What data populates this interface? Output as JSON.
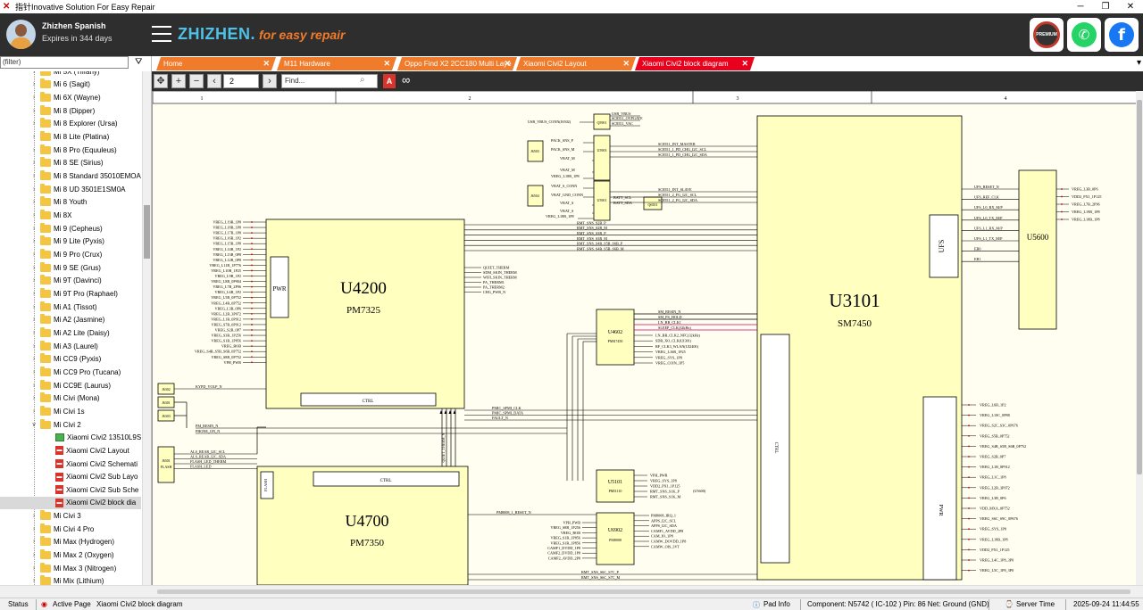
{
  "window": {
    "title": "指针Inovative Solution For Easy Repair",
    "controls": [
      "─",
      "❐",
      "✕"
    ]
  },
  "header": {
    "user_name": "Zhizhen Spanish",
    "expires": "Expires in 344 days",
    "brand": "ZHIZHEN.",
    "tagline": "for easy repair",
    "premium_label": "PREMIUM",
    "whatsapp_glyph": "✆",
    "facebook_glyph": "f"
  },
  "sidebar": {
    "filter_placeholder": "(filter)",
    "items": [
      {
        "label": "Mi 5X (Tiffany)",
        "type": "folder"
      },
      {
        "label": "Mi 6 (Sagit)",
        "type": "folder"
      },
      {
        "label": "Mi 6X (Wayne)",
        "type": "folder"
      },
      {
        "label": "Mi 8 (Dipper)",
        "type": "folder"
      },
      {
        "label": "Mi 8 Explorer (Ursa)",
        "type": "folder"
      },
      {
        "label": "Mi 8 Lite (Platina)",
        "type": "folder"
      },
      {
        "label": "Mi 8 Pro (Equuleus)",
        "type": "folder"
      },
      {
        "label": "Mi 8 SE (Sirius)",
        "type": "folder"
      },
      {
        "label": "Mi 8 Standard 35010EMOA",
        "type": "folder"
      },
      {
        "label": "Mi 8 UD 3501E1SM0A",
        "type": "folder"
      },
      {
        "label": "Mi 8 Youth",
        "type": "folder"
      },
      {
        "label": "Mi 8X",
        "type": "folder"
      },
      {
        "label": "Mi 9 (Cepheus)",
        "type": "folder"
      },
      {
        "label": "Mi 9 Lite (Pyxis)",
        "type": "folder"
      },
      {
        "label": "Mi 9 Pro (Crux)",
        "type": "folder"
      },
      {
        "label": "Mi 9 SE (Grus)",
        "type": "folder"
      },
      {
        "label": "Mi 9T (Davinci)",
        "type": "folder"
      },
      {
        "label": "Mi 9T Pro (Raphael)",
        "type": "folder"
      },
      {
        "label": "Mi A1 (Tissot)",
        "type": "folder"
      },
      {
        "label": "Mi A2 (Jasmine)",
        "type": "folder"
      },
      {
        "label": "Mi A2 Lite (Daisy)",
        "type": "folder"
      },
      {
        "label": "Mi A3 (Laurel)",
        "type": "folder"
      },
      {
        "label": "Mi CC9 (Pyxis)",
        "type": "folder"
      },
      {
        "label": "Mi CC9 Pro (Tucana)",
        "type": "folder"
      },
      {
        "label": "Mi CC9E (Laurus)",
        "type": "folder"
      },
      {
        "label": "Mi Civi (Mona)",
        "type": "folder"
      },
      {
        "label": "Mi Civi 1s",
        "type": "folder"
      },
      {
        "label": "Mi Civi 2",
        "type": "folder-open"
      },
      {
        "label": "Xiaomi Civi2 13510L9S",
        "type": "bitmap"
      },
      {
        "label": "Xiaomi Civi2 Layout",
        "type": "pdf"
      },
      {
        "label": "Xiaomi Civi2 Schemati",
        "type": "pdf"
      },
      {
        "label": "Xiaomi Civi2 Sub Layo",
        "type": "pdf"
      },
      {
        "label": "Xiaomi Civi2 Sub Sche",
        "type": "pdf"
      },
      {
        "label": "Xiaomi Civi2 block dia",
        "type": "pdf",
        "selected": true
      },
      {
        "label": "Mi Civi 3",
        "type": "folder"
      },
      {
        "label": "Mi Civi 4 Pro",
        "type": "folder"
      },
      {
        "label": "Mi Max (Hydrogen)",
        "type": "folder"
      },
      {
        "label": "Mi Max 2 (Oxygen)",
        "type": "folder"
      },
      {
        "label": "Mi Max 3 (Nitrogen)",
        "type": "folder"
      },
      {
        "label": "Mi Mix (Lithium)",
        "type": "folder"
      }
    ]
  },
  "tabs": [
    {
      "label": "Home",
      "active": false
    },
    {
      "label": "M11 Hardware",
      "active": false
    },
    {
      "label": "Oppo Find X2 2CC180 Multi Laye",
      "active": false
    },
    {
      "label": "Xiaomi Civi2 Layout",
      "active": false
    },
    {
      "label": "Xiaomi Civi2 block diagram",
      "active": true
    }
  ],
  "toolbar": {
    "page": "2",
    "find_placeholder": "Find...",
    "pdf_label": "A"
  },
  "schematic": {
    "columns": [
      "1",
      "2",
      "3",
      "4"
    ],
    "u4200": {
      "name": "U4200",
      "part": "PM7325",
      "pwr": "PWR",
      "ctrl": "CTRL"
    },
    "u3101": {
      "name": "U3101",
      "part": "SM7450",
      "ctrl": "CTRL",
      "pwr": "PWR"
    },
    "u4700": {
      "name": "U4700",
      "part": "PM7350",
      "flash": "FLASH",
      "ctrl": "CTRL"
    },
    "u5600": {
      "name": "U5600",
      "ufs": "UFS"
    },
    "u4602": {
      "name": "U4602",
      "part": "PMK7450"
    },
    "u5101": {
      "name": "U5101",
      "part": "PMI1110"
    },
    "u6902": {
      "name": "U6902",
      "part": "PM8008"
    },
    "small_parts": [
      "Q5901",
      "U5903",
      "J6503",
      "J6504",
      "U5901",
      "Q6501",
      "J6302",
      "J6301",
      "J6303",
      "J6501",
      "FLASH"
    ],
    "u4200_left_nets": [
      "VREG_L19B_1P8",
      "VREG_L18B_1P8",
      "VREG_L17B_1P8",
      "VREG_L16B_1P2",
      "VREG_L15B_1P8",
      "VREG_L14B_1P2",
      "VREG_L13B_0P8",
      "VREG_L12B_0P8",
      "VREG_L11B_1P776",
      "VREG_L10B_1P25",
      "VREG_L9B_1P2",
      "VREG_L8B_0P904",
      "VREG_L7B_2P96",
      "VREG_L6B_1P2",
      "VREG_L5B_0P752",
      "VREG_L4B_0P752",
      "VREG_L3B_0P6",
      "VREG_L2B_3P072",
      "VREG_L1B_0P912",
      "VREG_S7B_0P912",
      "VREG_S2B_0P7",
      "VREG_S3B_1P256",
      "VREG_S1B_1P856",
      "VREG_BOB",
      "VREG_S4B_S5B_S6B_0P752",
      "VREG_S8B_0P752",
      "VPH_PWR"
    ],
    "u4200_right_nets": [
      "QUIET_THERM",
      "SDM_SKIN_THERM",
      "WIFI_SKIN_THERM",
      "PA_THERM1",
      "PA_THERM2",
      "CHG_PWR_N"
    ],
    "top_bus_nets": [
      "RMT_SNS_S2B_P",
      "RMT_SNS_S2B_M",
      "RMT_SNS_S3B_P",
      "RMT_SNS_S3B_M",
      "RMT_SNS_S4B_S5B_S6B_P",
      "RMT_SNS_S4B_S5B_S6B_M"
    ],
    "u4602_left_nets": [
      "SM_RESIN_N",
      "SM_PS_HOLD",
      "LN_BB_CLK1",
      "SLEEP_CLK(32kHz)"
    ],
    "u4602_right_nets": [
      "LN_BB_CLK2_NFC(32kHz)",
      "SDR_XO_CLK(UI301)",
      "RF_CLK3_WLAN(UI2400)",
      "VREG_L16B_1P25",
      "VREG_SYS_1P8",
      "VREG_COIN_1P5"
    ],
    "pmic_nets": [
      "PMIC_SPMI_CLK",
      "PMIC_SPMI_DATA",
      "FAULT_N"
    ],
    "reset_nets": [
      "PM_RESIN_N",
      "PHONE_ON_N"
    ],
    "kypd": "KYPD_VOLP_N",
    "flash_nets": [
      "ALS_REAR_I2C_SCL",
      "ALS_REAR_I2C_SDA",
      "FLASH_LED_THERM",
      "FLASH_LED"
    ],
    "u5101_nets": [
      "VPH_PWR",
      "VREG_SYS_1P8",
      "VDD2_PX1_1P125",
      "RMT_SNS_S1K_P",
      "RMT_SNS_S1K_M"
    ],
    "u5500_label": "(U5600)",
    "u6902_left_nets": [
      "VPH_PWR",
      "VREG_S8B_1P256",
      "VREG_BOB",
      "VREG_S1B_1P856",
      "VREG_S1B_1P856",
      "CAMF1_DVDD_1P8",
      "CAMF2_DVDD_1P8",
      "CAMF2_AVDD_2P8"
    ],
    "u6902_right_nets": [
      "PM8008_IRQ_1",
      "APPS_I2C_SCL",
      "APPS_I2C_SDA",
      "CAMF1_AVDD_2P8",
      "CAM_IO_1P8",
      "CAMW_DOVDD_1P8",
      "CAMW_OIS_3VT"
    ],
    "pm8008_reset": "PM8008_1_RESET_N",
    "bottom_nets": [
      "RMT_SNS_S6C_S7C_P",
      "RMT_SNS_S6C_S7C_M"
    ],
    "u5600_left_nets": [
      "UFS_RESET_N",
      "UFS_REF_CLK",
      "UFS_L0_RX_M/P",
      "UFS_L0_TX_M/P",
      "UFS_L1_RX_M/P",
      "UFS_L1_TX_M/P",
      "EB0",
      "EB1"
    ],
    "u5600_right_nets": [
      "VREG_L3B_0P6",
      "VDD2_PX1_1P125",
      "VREG_L7B_2P96",
      "VREG_L19B_1P8",
      "VREG_L18B_1P8"
    ],
    "u3101_right_nets": [
      "VREG_L6B_1P2",
      "VREG_L10C_0P88",
      "VREG_S2C_S3C_0P676",
      "VREG_S5B_0P752",
      "VREG_S4B_S5B_S6B_0P752",
      "VREG_S2B_0P7",
      "VREG_L1B_0P912",
      "VREG_L1C_1P8",
      "VREG_L2B_3P072",
      "VREG_L3B_0P6",
      "VDD_MXA_0P752",
      "VREG_S6C_S9C_0P676",
      "VREG_SYS_1P8",
      "VREG_L18B_1P8",
      "VDD2_PX1_1P125",
      "VREG_L4C_1P8_3P0",
      "VREG_L5C_1P8_3P0"
    ],
    "vbat_nets": [
      "USB_VBUS_CONN(J6502)",
      "USB_VBUS",
      "SC8551_OVPGATE",
      "SC8551_VAC",
      "PACK_SNS_P",
      "PACK_SNS_M",
      "VBAT_M",
      "VBAT_M",
      "VREG_L18B_1P8",
      "VBAT_S_CONN",
      "VBAT_GND_CONN",
      "VBAT_S",
      "VBAT_S",
      "VREG_L18B_1P8",
      "BATT_SCL",
      "BATT_SDA"
    ],
    "sc8551_nets": [
      "SC8551_INT_MASTER",
      "SC8551_1_PD_CHG_I2C_SCL",
      "SC8551_1_PD_CHG_I2C_SDA",
      "SC8551_INT_SLAVE",
      "SC8551_2_FG_I2C_SCL",
      "SC8551_2_FG_I2C_SDA"
    ],
    "quiet_label": "QUIET_THERM_N"
  },
  "status": {
    "status_label": "Status",
    "active_page_label": "Active Page",
    "active_page_value": "Xiaomi Civi2 block diagram",
    "pad_info": "Pad Info",
    "component": "Component: N5742 ( IC-102 ) Pin: 86 Net: Ground (GND)",
    "server_time_label": "Server Time",
    "datetime": "2025-09-24 11:44:55"
  },
  "colors": {
    "accent_orange": "#f07b2a",
    "active_tab": "#e8001c",
    "brand_blue": "#4ec1e8",
    "chip_fill": "#ffffc0",
    "header_bg": "#2e2e2e"
  }
}
